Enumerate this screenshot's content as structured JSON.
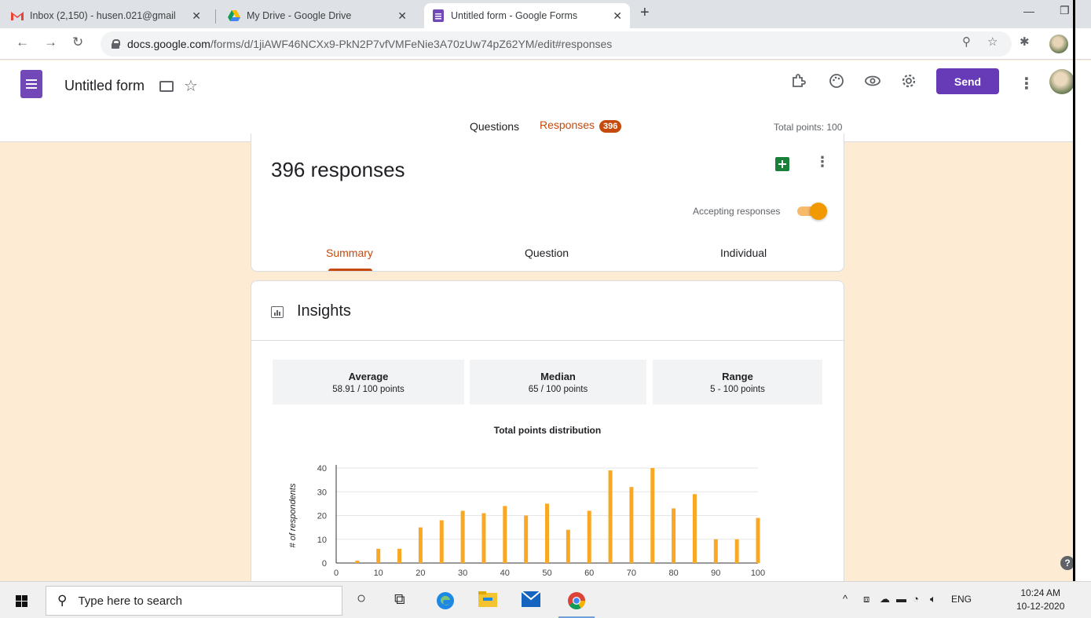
{
  "browser": {
    "tabs": [
      {
        "title": "Inbox (2,150) - husen.021@gmail",
        "icon": "gmail-icon"
      },
      {
        "title": "My Drive - Google Drive",
        "icon": "drive-icon"
      },
      {
        "title": "Untitled form - Google Forms",
        "icon": "forms-icon",
        "active": true
      }
    ],
    "new_tab": "+",
    "url_host": "docs.google.com",
    "url_path": "/forms/d/1jiAWF46NCXx9-PkN2P7vfVMFeNie3A70zUw74pZ62YM/edit#responses"
  },
  "form": {
    "title": "Untitled form",
    "send_label": "Send",
    "tabs": {
      "questions": "Questions",
      "responses": "Responses",
      "responses_badge": "396"
    },
    "total_points": "Total points: 100"
  },
  "responses": {
    "count_label": "396 responses",
    "accepting_label": "Accepting responses",
    "accepting": true,
    "subtabs": {
      "summary": "Summary",
      "question": "Question",
      "individual": "Individual"
    }
  },
  "insights": {
    "title": "Insights",
    "stats": [
      {
        "title": "Average",
        "value": "58.91 / 100 points"
      },
      {
        "title": "Median",
        "value": "65 / 100 points"
      },
      {
        "title": "Range",
        "value": "5 - 100 points"
      }
    ]
  },
  "chart_data": {
    "type": "bar",
    "title": "Total points distribution",
    "xlabel": "",
    "ylabel": "# of respondents",
    "x": [
      5,
      10,
      15,
      20,
      25,
      30,
      35,
      40,
      45,
      50,
      55,
      60,
      65,
      70,
      75,
      80,
      85,
      90,
      95,
      100
    ],
    "values": [
      1,
      6,
      6,
      15,
      18,
      22,
      21,
      24,
      20,
      25,
      14,
      22,
      39,
      32,
      40,
      23,
      29,
      10,
      10,
      19
    ],
    "xlim": [
      0,
      100
    ],
    "ylim": [
      0,
      40
    ],
    "xticks": [
      0,
      10,
      20,
      30,
      40,
      50,
      60,
      70,
      80,
      90,
      100
    ],
    "yticks": [
      0,
      10,
      20,
      30,
      40
    ],
    "grid": true,
    "bar_color": "#f9a825"
  },
  "taskbar": {
    "search_placeholder": "Type here to search",
    "lang": "ENG",
    "time": "10:24 AM",
    "date": "10-12-2020"
  },
  "colors": {
    "accent": "#673ab7",
    "responses_orange": "#c64a0b",
    "background": "#fdebd3"
  }
}
